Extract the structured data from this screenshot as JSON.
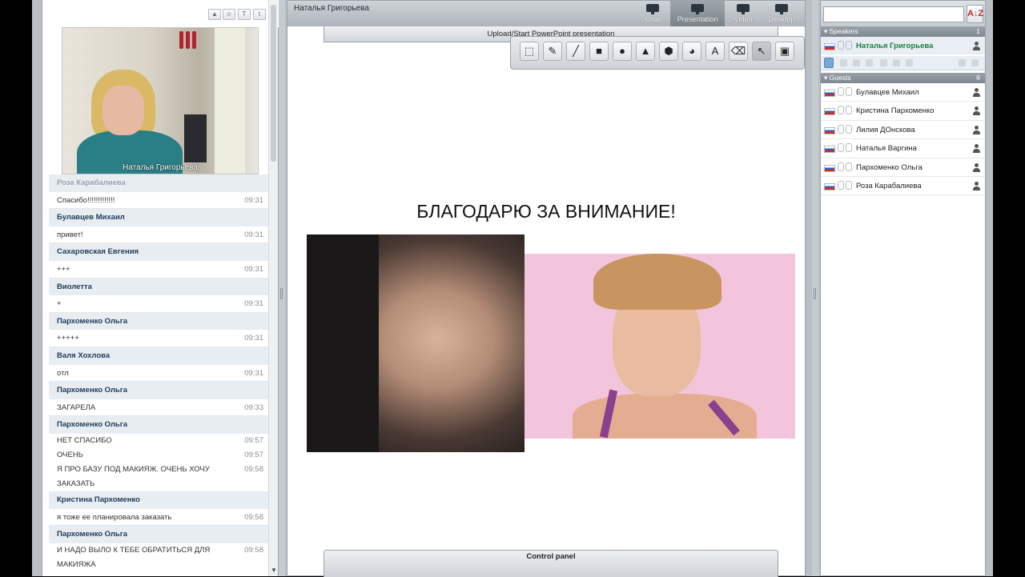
{
  "chat": {
    "video_name": "Наталья Григорьева",
    "messages": [
      {
        "kind": "author",
        "text": "Роза Карабалиева",
        "faded": true
      },
      {
        "kind": "msg",
        "text": "Спасибо!!!!!!!!!!!!!",
        "time": "09:31",
        "faded": true
      },
      {
        "kind": "author",
        "text": "Булавцев Михаил"
      },
      {
        "kind": "msg",
        "text": "привет!",
        "time": "09:31"
      },
      {
        "kind": "author",
        "text": "Сахаровская Евгения"
      },
      {
        "kind": "msg",
        "text": "+++",
        "time": "09:31"
      },
      {
        "kind": "author",
        "text": "Виолетта"
      },
      {
        "kind": "msg",
        "text": "+",
        "time": "09:31"
      },
      {
        "kind": "author",
        "text": "Пархоменко Ольга"
      },
      {
        "kind": "msg",
        "text": "+++++",
        "time": "09:31"
      },
      {
        "kind": "author",
        "text": "Валя Хохлова"
      },
      {
        "kind": "msg",
        "text": "отл",
        "time": "09:31"
      },
      {
        "kind": "author",
        "text": "Пархоменко Ольга"
      },
      {
        "kind": "msg",
        "text": "ЗАГАРЕЛА",
        "time": "09:33"
      },
      {
        "kind": "author",
        "text": "Пархоменко Ольга"
      },
      {
        "kind": "small",
        "text": "НЕТ СПАСИБО",
        "time": "09:57"
      },
      {
        "kind": "small",
        "text": "ОЧЕНЬ",
        "time": "09:57"
      },
      {
        "kind": "small",
        "text": "Я ПРО БАЗУ ПОД МАКИЯЖ. ОЧЕНЬ ХОЧУ",
        "time": "09:58"
      },
      {
        "kind": "small",
        "text": "ЗАКАЗАТЬ",
        "time": ""
      },
      {
        "kind": "author",
        "text": "Кристина Пархоменко"
      },
      {
        "kind": "msg",
        "text": "я тоже ее планировала заказать",
        "time": "09:58"
      },
      {
        "kind": "author",
        "text": "Пархоменко Ольга"
      },
      {
        "kind": "small",
        "text": "И НАДО ВЫЛО К ТЕБЕ ОБРАТИТЬСЯ ДЛЯ",
        "time": "09:58"
      },
      {
        "kind": "small",
        "text": "МАКИЯЖА",
        "time": ""
      }
    ]
  },
  "center": {
    "title": "Наталья Григорьева",
    "modes": [
      {
        "label": "Chat",
        "icon": "chat-bubble-icon",
        "active": false
      },
      {
        "label": "Presentation",
        "icon": "presentation-board-icon",
        "active": true
      },
      {
        "label": "Video",
        "icon": "monitor-icon",
        "active": false
      },
      {
        "label": "Desktop",
        "icon": "desktop-icon",
        "active": false
      }
    ],
    "upload_label": "Upload/Start PowerPoint presentation",
    "slide_title": "БЛАГОДАРЮ ЗА ВНИМАНИЕ!",
    "control_panel_label": "Control panel",
    "draw_tools": [
      {
        "name": "select-area-icon",
        "glyph": "⬚"
      },
      {
        "name": "pencil-icon",
        "glyph": "✎"
      },
      {
        "name": "line-icon",
        "glyph": "╱"
      },
      {
        "name": "rectangle-icon",
        "glyph": "■"
      },
      {
        "name": "circle-icon",
        "glyph": "●"
      },
      {
        "name": "triangle-icon",
        "glyph": "▲"
      },
      {
        "name": "hexagon-icon",
        "glyph": "⬢"
      },
      {
        "name": "pie-icon",
        "glyph": "◕"
      },
      {
        "name": "text-icon",
        "glyph": "A"
      },
      {
        "name": "eraser-icon",
        "glyph": "⌫"
      },
      {
        "name": "pointer-icon",
        "glyph": "↖"
      },
      {
        "name": "save-icon",
        "glyph": "▣"
      }
    ]
  },
  "right": {
    "sort_label": "A↓Z",
    "speakers_label": "Speakers",
    "speakers_count": "1",
    "speaker": "Наталья Григорьева",
    "guests_label": "Guests",
    "guests_count": "6",
    "guests": [
      "Булавцев Михаил",
      "Кристина Пархоменко",
      "Лилия ДОнскова",
      "Наталья Варгина",
      "Пархоменко Ольга",
      "Роза Карабалиева"
    ]
  }
}
